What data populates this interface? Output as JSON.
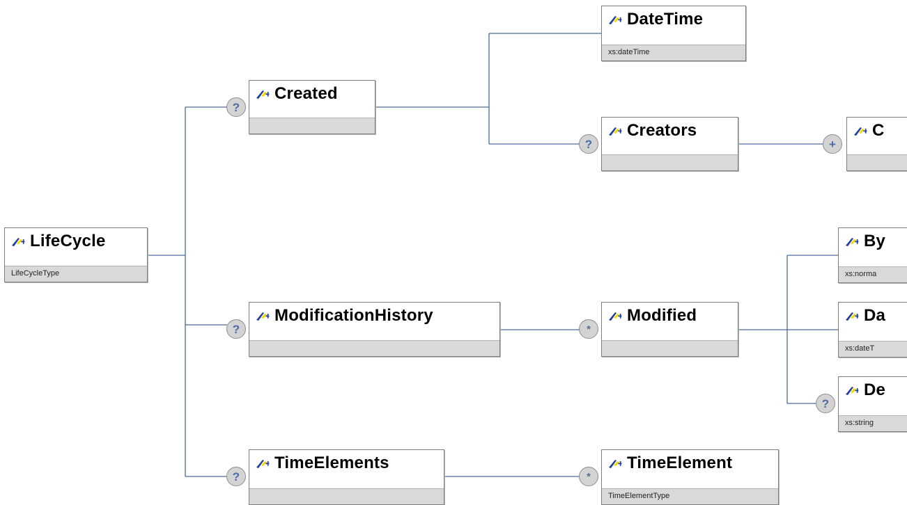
{
  "diagram": {
    "nodes": {
      "lifecycle": {
        "label": "LifeCycle",
        "type": "LifeCycleType"
      },
      "created": {
        "label": "Created",
        "type": ""
      },
      "datetime_top": {
        "label": "DateTime",
        "type": "xs:dateTime"
      },
      "creators": {
        "label": "Creators",
        "type": ""
      },
      "creator_child": {
        "label": "C",
        "type": ""
      },
      "modification_history": {
        "label": "ModificationHistory",
        "type": ""
      },
      "modified": {
        "label": "Modified",
        "type": ""
      },
      "by": {
        "label": "By",
        "type": "xs:norma"
      },
      "date": {
        "label": "Da",
        "type": "xs:dateT"
      },
      "description": {
        "label": "De",
        "type": "xs:string"
      },
      "time_elements": {
        "label": "TimeElements",
        "type": ""
      },
      "time_element": {
        "label": "TimeElement",
        "type": "TimeElementType"
      }
    },
    "badges": {
      "optional": "?",
      "zero_or_more": "*",
      "one_or_more": "+"
    }
  },
  "colors": {
    "connector": "#4a6a9a",
    "type_band": "#d9d9d9",
    "node_border": "#7d7d7d",
    "icon_blue": "#1f3f9c",
    "icon_yellow": "#f5d800"
  }
}
